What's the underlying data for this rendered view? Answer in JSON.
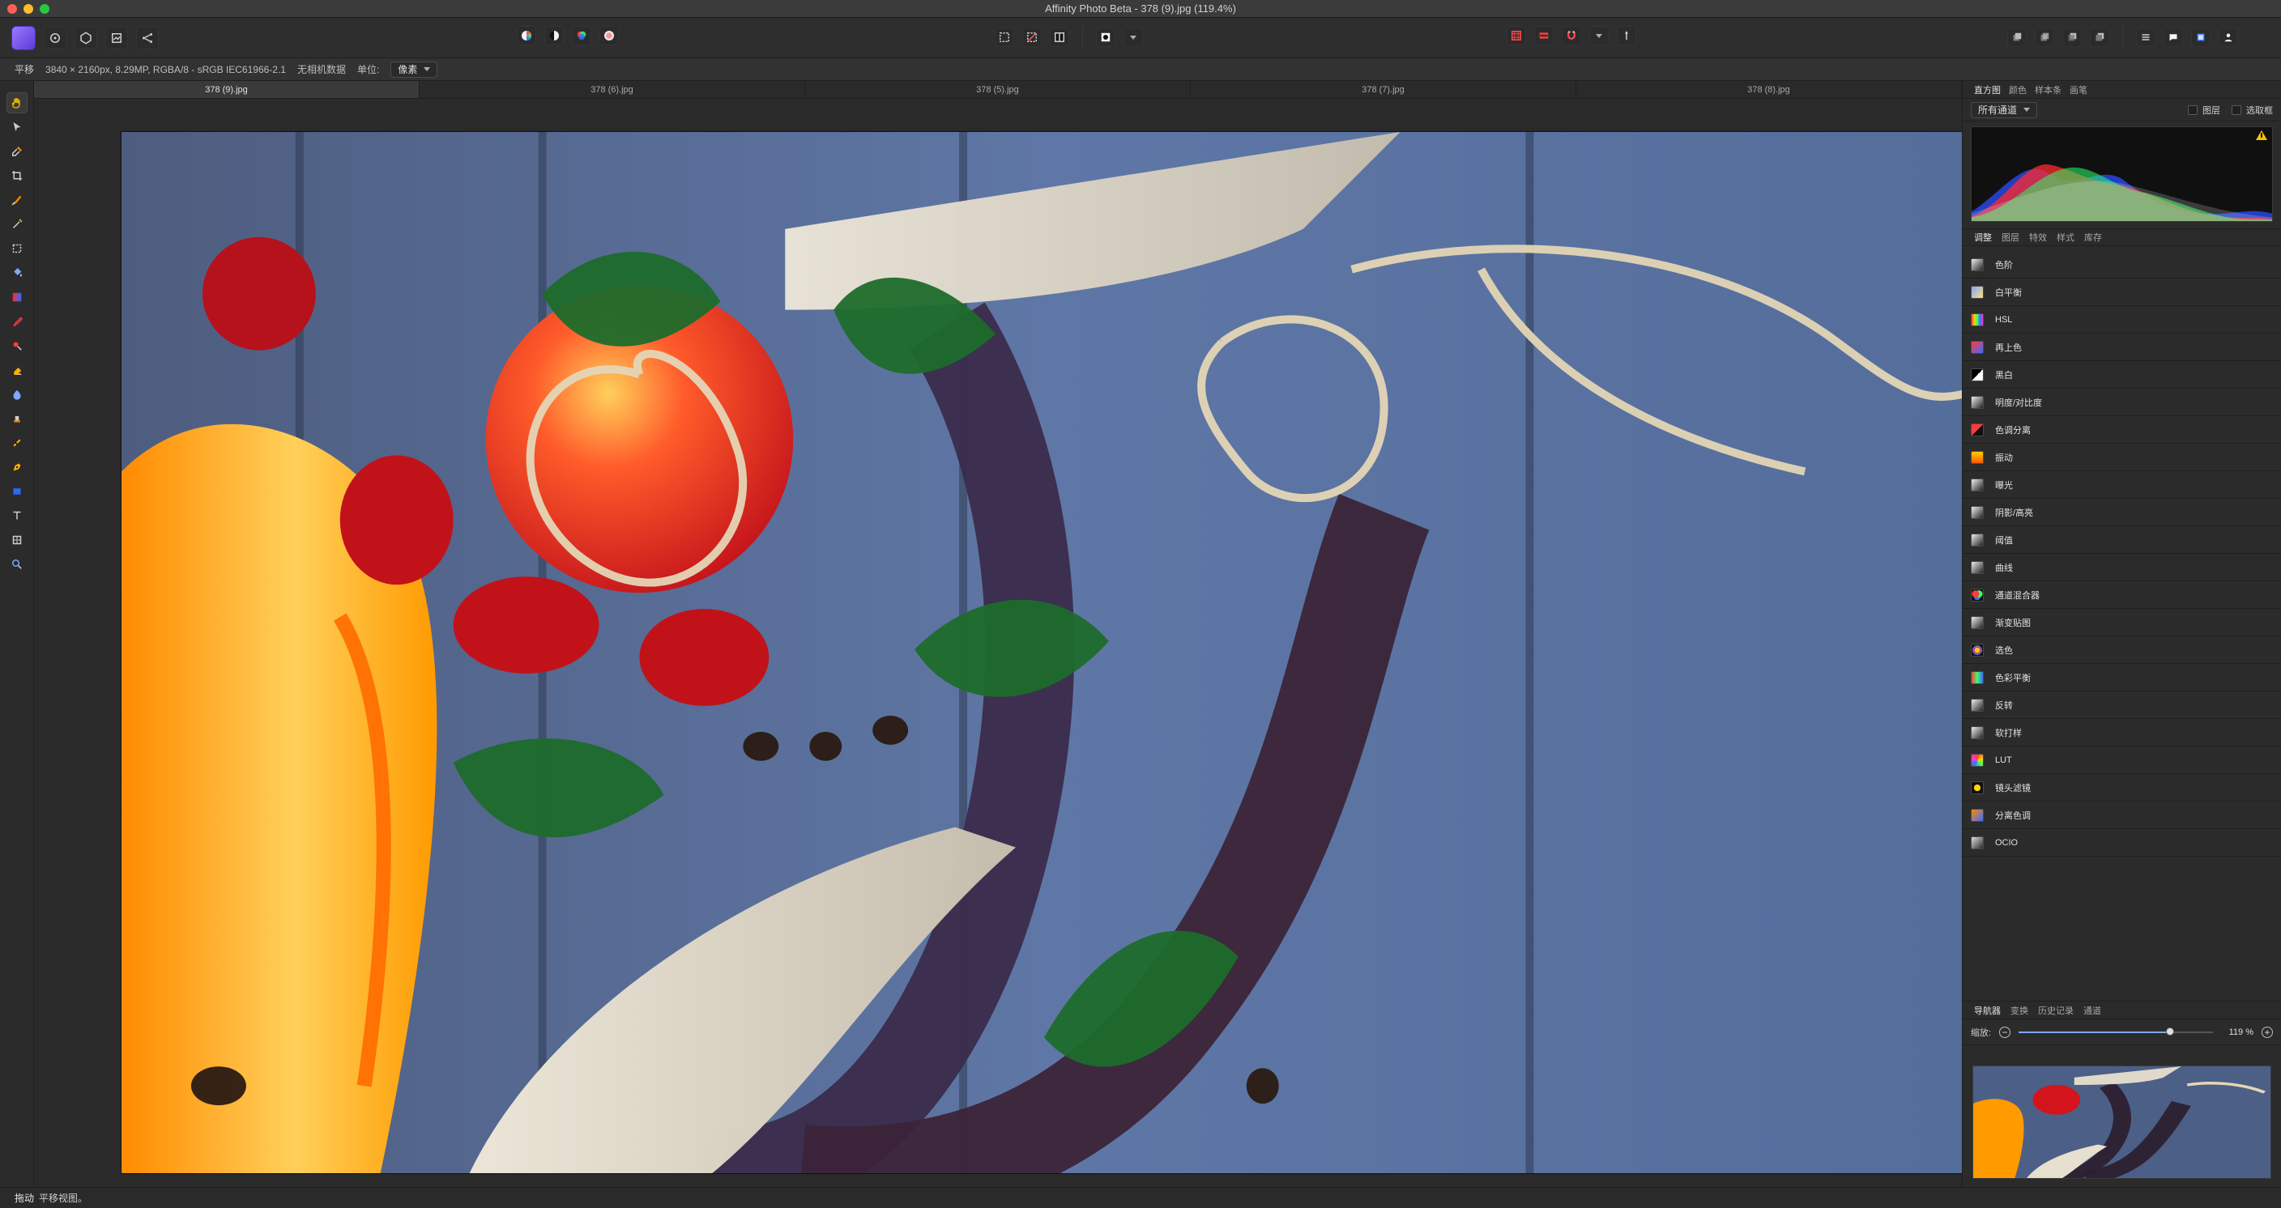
{
  "window": {
    "title": "Affinity Photo Beta - 378 (9).jpg (119.4%)"
  },
  "context_toolbar": {
    "tool_name": "平移",
    "document_info": "3840 × 2160px, 8.29MP, RGBA/8 - sRGB IEC61966-2.1",
    "camera_data": "无相机数据",
    "units_label": "单位:",
    "units_value": "像素"
  },
  "document_tabs": [
    {
      "label": "378 (9).jpg",
      "active": true
    },
    {
      "label": "378 (6).jpg",
      "active": false
    },
    {
      "label": "378 (5).jpg",
      "active": false
    },
    {
      "label": "378 (7).jpg",
      "active": false
    },
    {
      "label": "378 (8).jpg",
      "active": false
    }
  ],
  "right_panel": {
    "top_tabs": [
      "直方图",
      "颜色",
      "样本条",
      "画笔"
    ],
    "active_top_tab": "直方图",
    "histogram": {
      "channel_value": "所有通道",
      "layer_checkbox": "图层",
      "selection_checkbox": "选取框"
    },
    "adjust_tabs": [
      "调整",
      "图层",
      "特效",
      "样式",
      "库存"
    ],
    "active_adjust_tab": "调整",
    "adjustments": [
      {
        "label": "色阶",
        "icon": "levels-icon"
      },
      {
        "label": "白平衡",
        "icon": "white-balance-icon"
      },
      {
        "label": "HSL",
        "icon": "hsl-icon"
      },
      {
        "label": "再上色",
        "icon": "recolor-icon"
      },
      {
        "label": "黑白",
        "icon": "black-white-icon"
      },
      {
        "label": "明度/对比度",
        "icon": "brightness-contrast-icon"
      },
      {
        "label": "色调分离",
        "icon": "posterize-icon"
      },
      {
        "label": "振动",
        "icon": "vibrance-icon"
      },
      {
        "label": "曝光",
        "icon": "exposure-icon"
      },
      {
        "label": "阴影/高亮",
        "icon": "shadows-highlights-icon"
      },
      {
        "label": "阈值",
        "icon": "threshold-icon"
      },
      {
        "label": "曲线",
        "icon": "curves-icon"
      },
      {
        "label": "通道混合器",
        "icon": "channel-mixer-icon"
      },
      {
        "label": "渐变贴图",
        "icon": "gradient-map-icon"
      },
      {
        "label": "选色",
        "icon": "selective-color-icon"
      },
      {
        "label": "色彩平衡",
        "icon": "color-balance-icon"
      },
      {
        "label": "反转",
        "icon": "invert-icon"
      },
      {
        "label": "软打样",
        "icon": "soft-proof-icon"
      },
      {
        "label": "LUT",
        "icon": "lut-icon"
      },
      {
        "label": "镜头滤镜",
        "icon": "lens-filter-icon"
      },
      {
        "label": "分离色调",
        "icon": "split-toning-icon"
      },
      {
        "label": "OCIO",
        "icon": "ocio-icon"
      }
    ],
    "navigator": {
      "tabs": [
        "导航器",
        "变换",
        "历史记录",
        "通道"
      ],
      "active_tab": "导航器",
      "zoom_label": "缩放:",
      "zoom_value": "119 %",
      "zoom_fraction": 0.78
    }
  },
  "status_bar": {
    "action": "拖动",
    "message": "平移视图。"
  },
  "colors": {
    "persona_accent": "#8f6cff",
    "zoom_accent": "#7fa7ff",
    "warning": "#f4c400"
  }
}
